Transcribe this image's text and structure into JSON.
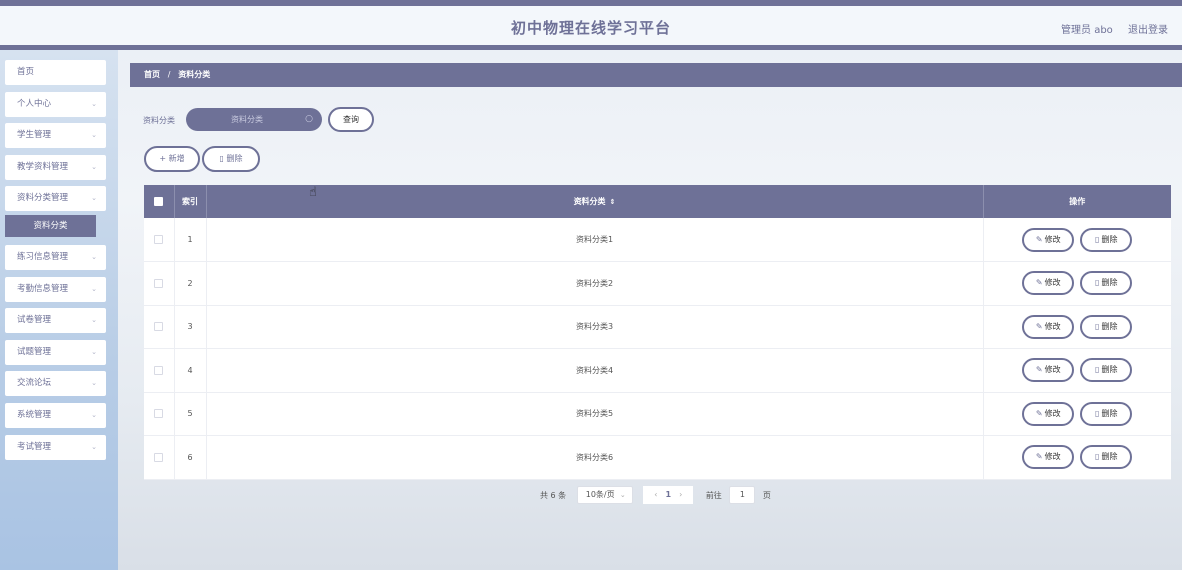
{
  "header": {
    "site_title": "初中物理在线学习平台",
    "user_label": "管理员 abo",
    "logout_label": "退出登录"
  },
  "sidebar": {
    "items": [
      {
        "label": "首页",
        "has_chevron": false
      },
      {
        "label": "个人中心",
        "has_chevron": true
      },
      {
        "label": "学生管理",
        "has_chevron": true
      },
      {
        "label": "教学资料管理",
        "has_chevron": true
      },
      {
        "label": "资料分类管理",
        "has_chevron": true,
        "expanded": true
      },
      {
        "label": "练习信息管理",
        "has_chevron": true
      },
      {
        "label": "考勤信息管理",
        "has_chevron": true
      },
      {
        "label": "试卷管理",
        "has_chevron": true
      },
      {
        "label": "试题管理",
        "has_chevron": true
      },
      {
        "label": "交流论坛",
        "has_chevron": true
      },
      {
        "label": "系统管理",
        "has_chevron": true
      },
      {
        "label": "考试管理",
        "has_chevron": true
      }
    ],
    "active_sub": "资料分类",
    "chevron_glyph": "⌄"
  },
  "breadcrumb": {
    "home": "首页",
    "separator": "/",
    "current": "资料分类"
  },
  "search": {
    "label": "资料分类",
    "placeholder": "资料分类",
    "query_label": "查询"
  },
  "actions": {
    "add_label": "+ 新增",
    "delete_label": "删除"
  },
  "table": {
    "columns": {
      "index": "索引",
      "category": "资料分类",
      "ops": "操作"
    },
    "rows": [
      {
        "index": "1",
        "category": "资料分类1"
      },
      {
        "index": "2",
        "category": "资料分类2"
      },
      {
        "index": "3",
        "category": "资料分类3"
      },
      {
        "index": "4",
        "category": "资料分类4"
      },
      {
        "index": "5",
        "category": "资料分类5"
      },
      {
        "index": "6",
        "category": "资料分类6"
      }
    ],
    "edit_label": "修改",
    "delete_label": "删除"
  },
  "pagination": {
    "total": "共 6 条",
    "page_size": "10条/页",
    "current_page": "1",
    "goto_label": "前往",
    "goto_value": "1",
    "page_unit": "页"
  },
  "colors": {
    "primary": "#6e7197",
    "sidebar_bg": "#b8cde6",
    "header_bg": "#f3f7fb"
  }
}
